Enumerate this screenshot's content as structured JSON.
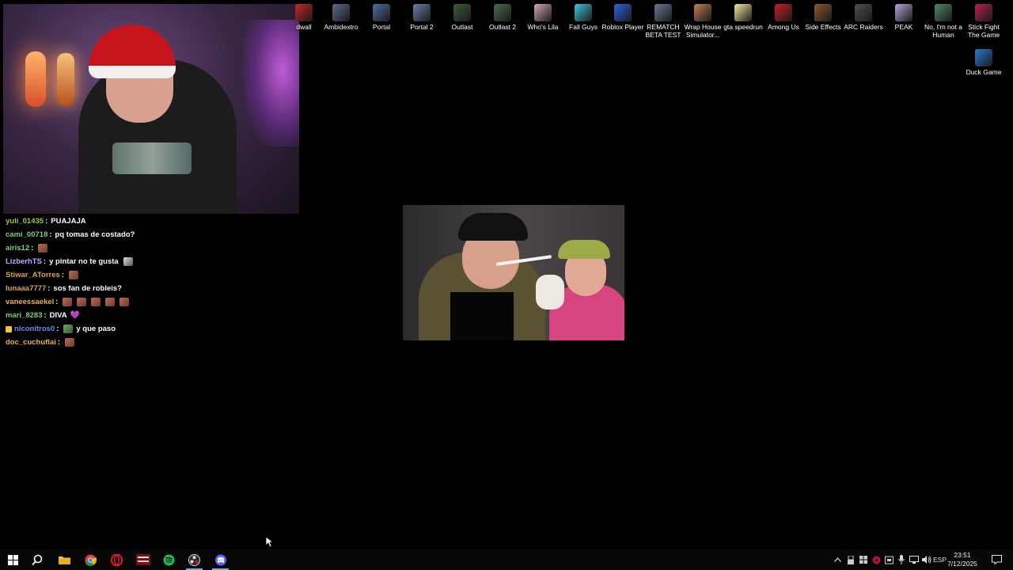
{
  "desktop_icons": [
    {
      "label": "dwall",
      "color": "#c9262b",
      "icon": "app-icon"
    },
    {
      "label": "Ambidextro",
      "color": "#5d6b8a",
      "icon": "game-icon"
    },
    {
      "label": "Portal",
      "color": "#4e6e9e",
      "icon": "portal-icon"
    },
    {
      "label": "Portal 2",
      "color": "#6e7fa6",
      "icon": "portal-icon"
    },
    {
      "label": "Outlast",
      "color": "#3a5a3a",
      "icon": "game-icon"
    },
    {
      "label": "Outlast 2",
      "color": "#4b6b4b",
      "icon": "game-icon"
    },
    {
      "label": "Who's Lila",
      "color": "#d2a8b3",
      "icon": "game-icon"
    },
    {
      "label": "Fall Guys",
      "color": "#3dc8d9",
      "icon": "game-icon"
    },
    {
      "label": "Roblox Player",
      "color": "#2d63e0",
      "icon": "roblox-icon"
    },
    {
      "label": "REMATCH\nBETA TEST",
      "color": "#6a7a93",
      "icon": "game-icon"
    },
    {
      "label": "Wrap House\nSimulator...",
      "color": "#c27f52",
      "icon": "game-icon"
    },
    {
      "label": "gta speedrun",
      "color": "#f4e9a0",
      "icon": "file-icon"
    },
    {
      "label": "Among Us",
      "color": "#c81e1e",
      "icon": "game-icon"
    },
    {
      "label": "Side Effects",
      "color": "#8a5a2a",
      "icon": "game-icon"
    },
    {
      "label": "ARC Raiders",
      "color": "#505050",
      "icon": "game-icon"
    },
    {
      "label": "PEAK",
      "color": "#b6a6d8",
      "icon": "game-icon"
    },
    {
      "label": "No, I'm not a\nHuman",
      "color": "#4e8a6a",
      "icon": "game-icon"
    },
    {
      "label": "Stick Fight\nThe Game",
      "color": "#b5224c",
      "icon": "game-icon"
    },
    {
      "label": "Duck Game",
      "color": "#2a7ad1",
      "icon": "game-icon"
    }
  ],
  "chat": [
    {
      "user": "yuli_01435",
      "color": "#9acd32",
      "msg": "PUAJAJA"
    },
    {
      "user": "cami_00718",
      "color": "#7fcf7a",
      "msg": "pq tomas de costado?"
    },
    {
      "user": "airis12",
      "color": "#7fcf7a",
      "msg": "",
      "emotes": 1
    },
    {
      "user": "LizberhTS",
      "color": "#b8b2ff",
      "msg": "y pintar no te gusta",
      "emotes_bw": 1
    },
    {
      "user": "Stiwar_ATorres",
      "color": "#d9a441",
      "msg": "",
      "emotes": 1
    },
    {
      "user": "lunaaa7777",
      "color": "#d9a441",
      "msg": "sos fan de robleis?"
    },
    {
      "user": "vaneessaekel",
      "color": "#e9b24e",
      "msg": "",
      "emotes": 5
    },
    {
      "user": "mari_8283",
      "color": "#7fcf7a",
      "msg": "DIVA",
      "heart": "💜"
    },
    {
      "user": "niconitros0",
      "color": "#6a8ff0",
      "msg": "y que paso",
      "badge": true,
      "emotes_green": 1
    },
    {
      "user": "doc_cuchuflai",
      "color": "#e9b24e",
      "msg": "",
      "emotes": 1
    }
  ],
  "taskbar": {
    "apps": [
      "start-icon",
      "search-icon",
      "file-explorer-icon",
      "chrome-icon",
      "opera-icon",
      "voicemeeter-icon",
      "spotify-icon",
      "obs-icon",
      "discord-icon"
    ],
    "language": "ESP",
    "time": "23:51",
    "date": "7/12/2025"
  }
}
